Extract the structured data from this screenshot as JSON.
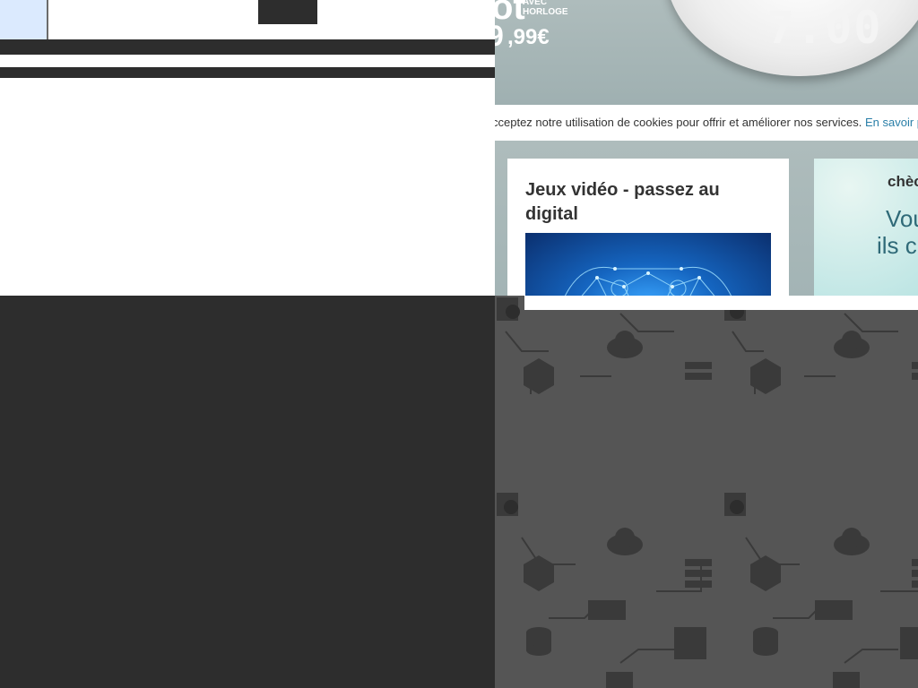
{
  "promo": {
    "product_word": "ot",
    "badge_line1": "AVEC",
    "badge_line2": "HORLOGE",
    "price_integer": "9",
    "price_decimal": ",99€",
    "clock_display": "7:00"
  },
  "cookie_notice": {
    "text": "cceptez notre utilisation de cookies pour offrir et améliorer nos services.",
    "link_text": "En savoir p"
  },
  "cards": [
    {
      "title": "Jeux vidéo - passez au digital"
    },
    {
      "brand": "chèc",
      "line1": "Vou",
      "line2": "ils ch"
    }
  ],
  "colors": {
    "page_background": "#2d2d2d",
    "link": "#2a7fa8",
    "hero_background": "#a7b7b8",
    "footer_pattern": "#555555"
  },
  "footer_icons": [
    "search-document-icon",
    "cloud-icon",
    "server-rack-icon",
    "database-icon",
    "hexagon-icon",
    "expand-arrows-icon",
    "network-switch-icon"
  ]
}
